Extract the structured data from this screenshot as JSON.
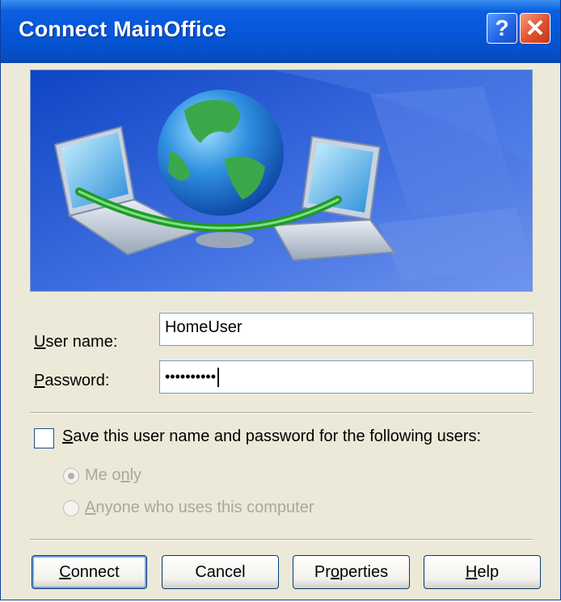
{
  "window": {
    "title": "Connect MainOffice",
    "help_label": "?",
    "close_label": "✕"
  },
  "icons": {
    "help": "help-icon",
    "close": "close-icon",
    "banner": "network-connection-illustration"
  },
  "form": {
    "username_label_accel": "U",
    "username_label_rest": "ser name:",
    "username_value": "HomeUser",
    "password_label_accel": "P",
    "password_label_rest": "assword:",
    "password_value": "••••••••••"
  },
  "save": {
    "label_accel": "S",
    "label_rest": "ave this user name and password for the following users:",
    "checked": false,
    "options": [
      {
        "label_pre": "Me o",
        "label_accel": "n",
        "label_post": "ly",
        "selected": true,
        "enabled": false
      },
      {
        "label_pre": "",
        "label_accel": "A",
        "label_post": "nyone who uses this computer",
        "selected": false,
        "enabled": false
      }
    ]
  },
  "buttons": {
    "connect_accel": "C",
    "connect_rest": "onnect",
    "cancel": "Cancel",
    "properties_pre": "Pr",
    "properties_accel": "o",
    "properties_post": "perties",
    "help_accel": "H",
    "help_rest": "elp"
  },
  "colors": {
    "titlebar": "#0656d8",
    "dialog_bg": "#ece9d8",
    "disabled_text": "#aca899"
  }
}
